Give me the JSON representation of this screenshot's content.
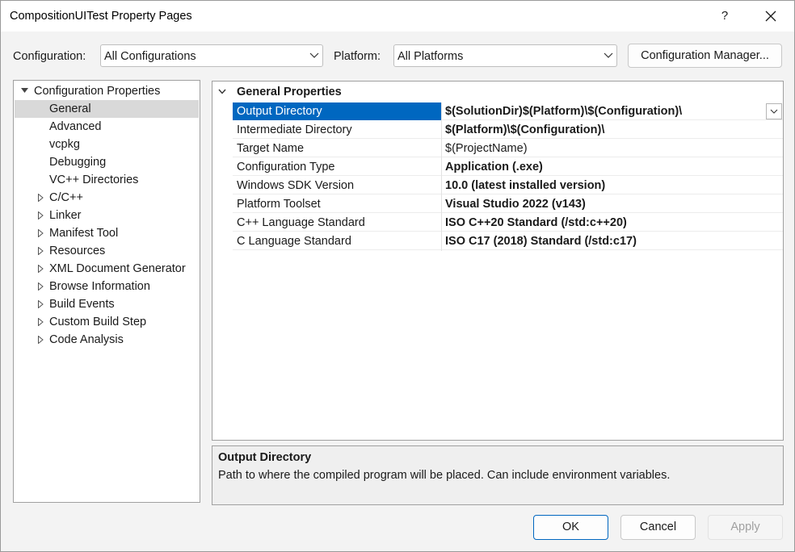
{
  "window": {
    "title": "CompositionUITest Property Pages"
  },
  "titlebar": {
    "help_label": "?"
  },
  "config_bar": {
    "configuration_label": "Configuration:",
    "configuration_value": "All Configurations",
    "platform_label": "Platform:",
    "platform_value": "All Platforms",
    "config_manager_label": "Configuration Manager..."
  },
  "tree": {
    "root": {
      "label": "Configuration Properties",
      "expanded": true
    },
    "items": [
      {
        "label": "General",
        "expandable": false,
        "selected": true
      },
      {
        "label": "Advanced",
        "expandable": false
      },
      {
        "label": "vcpkg",
        "expandable": false
      },
      {
        "label": "Debugging",
        "expandable": false
      },
      {
        "label": "VC++ Directories",
        "expandable": false
      },
      {
        "label": "C/C++",
        "expandable": true
      },
      {
        "label": "Linker",
        "expandable": true
      },
      {
        "label": "Manifest Tool",
        "expandable": true
      },
      {
        "label": "Resources",
        "expandable": true
      },
      {
        "label": "XML Document Generator",
        "expandable": true
      },
      {
        "label": "Browse Information",
        "expandable": true
      },
      {
        "label": "Build Events",
        "expandable": true
      },
      {
        "label": "Custom Build Step",
        "expandable": true
      },
      {
        "label": "Code Analysis",
        "expandable": true
      }
    ]
  },
  "grid": {
    "category": "General Properties",
    "properties": [
      {
        "name": "Output Directory",
        "value": "$(SolutionDir)$(Platform)\\$(Configuration)\\",
        "bold": true,
        "selected": true
      },
      {
        "name": "Intermediate Directory",
        "value": "$(Platform)\\$(Configuration)\\",
        "bold": true
      },
      {
        "name": "Target Name",
        "value": "$(ProjectName)",
        "bold": false
      },
      {
        "name": "Configuration Type",
        "value": "Application (.exe)",
        "bold": true
      },
      {
        "name": "Windows SDK Version",
        "value": "10.0 (latest installed version)",
        "bold": true
      },
      {
        "name": "Platform Toolset",
        "value": "Visual Studio 2022 (v143)",
        "bold": true
      },
      {
        "name": "C++ Language Standard",
        "value": "ISO C++20 Standard (/std:c++20)",
        "bold": true
      },
      {
        "name": "C Language Standard",
        "value": "ISO C17 (2018) Standard (/std:c17)",
        "bold": true
      }
    ]
  },
  "description": {
    "title": "Output Directory",
    "text": "Path to where the compiled program will be placed. Can include environment variables."
  },
  "buttons": {
    "ok": "OK",
    "cancel": "Cancel",
    "apply": "Apply"
  },
  "colors": {
    "selection": "#0067c0",
    "tree_selection": "#d9d9d9",
    "disabled_text": "#a0a0a0"
  }
}
